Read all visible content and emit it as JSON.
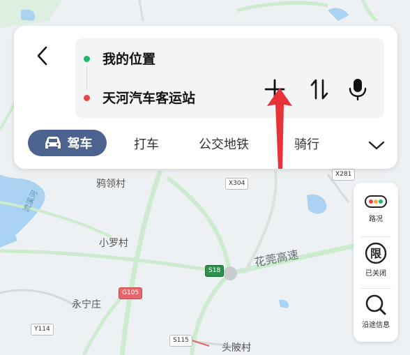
{
  "route": {
    "from": "我的位置",
    "to": "天河汽车客运站"
  },
  "modes": [
    {
      "label": "驾车",
      "active": true
    },
    {
      "label": "打车"
    },
    {
      "label": "公交地铁"
    },
    {
      "label": "骑行"
    }
  ],
  "side_panel": {
    "traffic": "路况",
    "restriction": "已关闭",
    "restriction_icon_char": "限",
    "along_route": "沿途信息"
  },
  "map_labels": {
    "place1": "鸦领村",
    "place2": "小罗村",
    "place3": "永宁庄",
    "place4": "头陂村",
    "highway": "花莞高速",
    "river": "流溪河"
  },
  "road_badges": {
    "x304": "X304",
    "x281": "X281",
    "s18": "S18",
    "g105": "G105",
    "y114": "Y114",
    "s115": "S115"
  },
  "colors": {
    "accent_tab": "#4c6390",
    "start_dot": "#1fb86a",
    "end_dot": "#e8444a",
    "annotation_arrow": "#e8323a"
  }
}
